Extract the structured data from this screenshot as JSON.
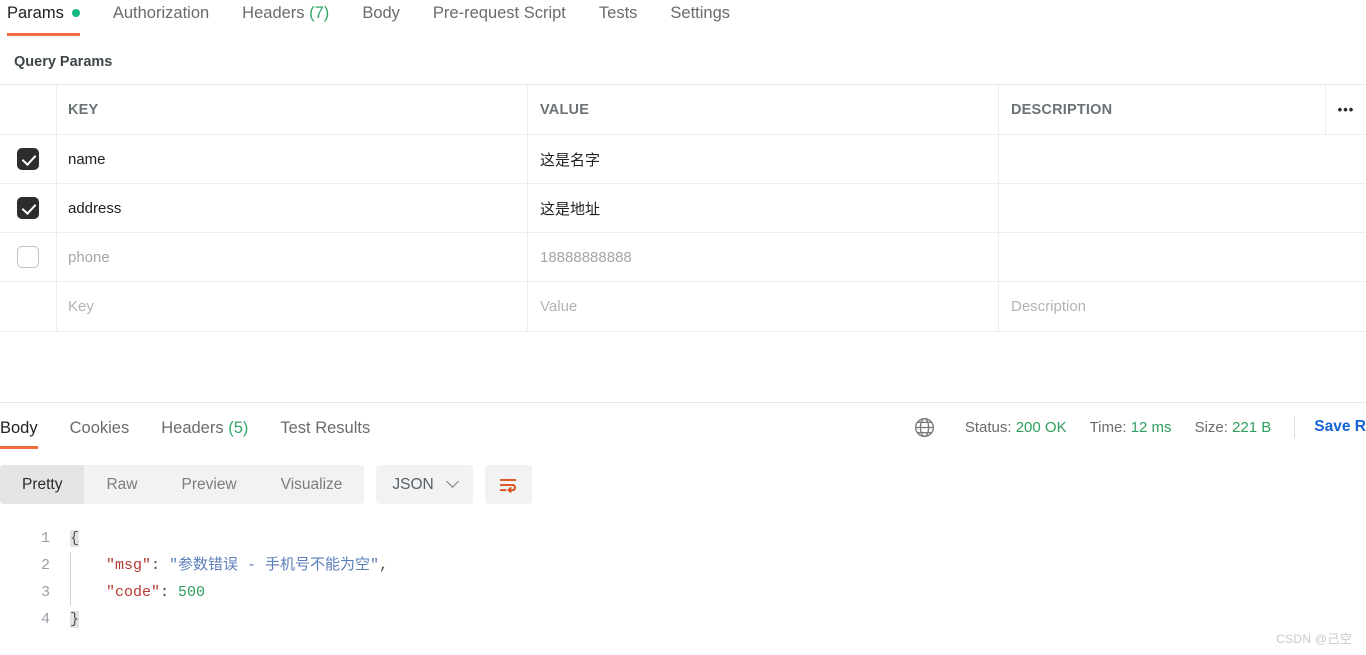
{
  "request_tabs": [
    {
      "label": "Params",
      "active": true,
      "dot": true
    },
    {
      "label": "Authorization",
      "active": false
    },
    {
      "label": "Headers",
      "count": "(7)",
      "active": false
    },
    {
      "label": "Body",
      "active": false
    },
    {
      "label": "Pre-request Script",
      "active": false
    },
    {
      "label": "Tests",
      "active": false
    },
    {
      "label": "Settings",
      "active": false
    }
  ],
  "params": {
    "section_title": "Query Params",
    "columns": {
      "key": "KEY",
      "value": "VALUE",
      "description": "DESCRIPTION"
    },
    "options_icon": "•••",
    "rows": [
      {
        "checked": true,
        "key": "name",
        "value": "这是名字",
        "description": "",
        "muted": false
      },
      {
        "checked": true,
        "key": "address",
        "value": "这是地址",
        "description": "",
        "muted": false
      },
      {
        "checked": false,
        "key": "phone",
        "value": "18888888888",
        "description": "",
        "muted": true
      }
    ],
    "new_row": {
      "key_placeholder": "Key",
      "value_placeholder": "Value",
      "description_placeholder": "Description"
    }
  },
  "response": {
    "tabs": [
      {
        "label": "Body",
        "active": true
      },
      {
        "label": "Cookies",
        "active": false
      },
      {
        "label": "Headers",
        "count": "(5)",
        "active": false
      },
      {
        "label": "Test Results",
        "active": false
      }
    ],
    "globe_icon": "globe-icon",
    "status_label": "Status:",
    "status_value": "200 OK",
    "time_label": "Time:",
    "time_value": "12 ms",
    "size_label": "Size:",
    "size_value": "221 B",
    "save_response": "Save R",
    "view_modes": [
      {
        "label": "Pretty",
        "active": true
      },
      {
        "label": "Raw",
        "active": false
      },
      {
        "label": "Preview",
        "active": false
      },
      {
        "label": "Visualize",
        "active": false
      }
    ],
    "format": "JSON",
    "wrap_icon": "wrap-lines-icon",
    "code": {
      "line_numbers": [
        "1",
        "2",
        "3",
        "4"
      ],
      "l1_brace": "{",
      "l2_key": "\"msg\"",
      "l2_colon": ": ",
      "l2_value": "\"参数错误 - 手机号不能为空\"",
      "l2_comma": ",",
      "l3_key": "\"code\"",
      "l3_colon": ": ",
      "l3_value": "500",
      "l4_brace": "}"
    }
  },
  "watermark": "CSDN @己空",
  "colors": {
    "accent_orange": "#f26b3a",
    "status_green": "#2f9e5e",
    "link_blue": "#1563d6",
    "dot_green": "#10b981"
  }
}
